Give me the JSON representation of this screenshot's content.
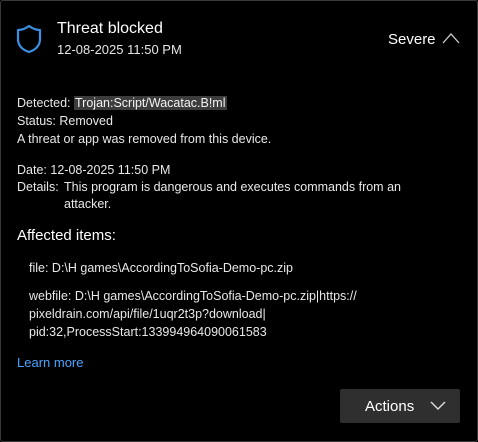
{
  "header": {
    "title": "Threat blocked",
    "timestamp": "12-08-2025 11:50 PM",
    "severity": "Severe"
  },
  "detection": {
    "detected_label": "Detected:",
    "detected_value": "Trojan:Script/Wacatac.B!ml",
    "status_label": "Status:",
    "status_value": "Removed",
    "message": "A threat or app was removed from this device.",
    "date_label": "Date:",
    "date_value": "12-08-2025 11:50 PM",
    "details_label": "Details:",
    "details_value": "This program is dangerous and executes commands from an attacker."
  },
  "affected": {
    "title": "Affected items:",
    "file_line": "file: D:\\H games\\AccordingToSofia-Demo-pc.zip",
    "webfile_line1": "webfile: D:\\H games\\AccordingToSofia-Demo-pc.zip|https://",
    "webfile_line2": "pixeldrain.com/api/file/1uqr2t3p?download|",
    "webfile_line3": "pid:32,ProcessStart:133994964090061583"
  },
  "learn_more": "Learn more",
  "actions_label": "Actions",
  "icons": {
    "shield": "shield-icon",
    "collapse": "chevron-up-icon",
    "actions": "chevron-down-icon"
  },
  "colors": {
    "accent": "#4aa3ff",
    "shield": "#3b8fe0",
    "background": "#000000"
  }
}
